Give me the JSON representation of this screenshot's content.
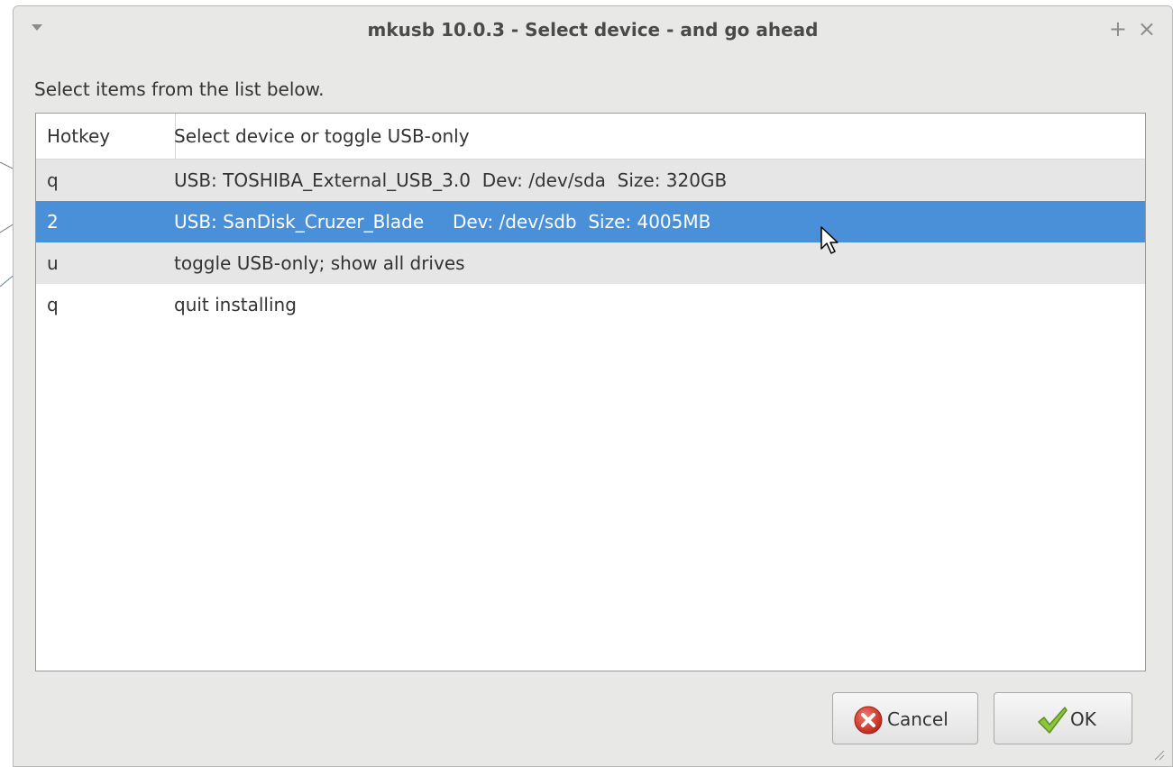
{
  "window": {
    "title": "mkusb 10.0.3 - Select device - and go ahead",
    "menu_icon": "chevron-down-icon",
    "maximize_symbol": "+",
    "close_symbol": "×"
  },
  "prompt": "Select items from the list below.",
  "list": {
    "columns": [
      "Hotkey",
      "Select device or toggle USB-only"
    ],
    "rows": [
      {
        "hotkey": "q",
        "description": "USB: TOSHIBA_External_USB_3.0  Dev: /dev/sda  Size: 320GB"
      },
      {
        "hotkey": "2",
        "description": "USB: SanDisk_Cruzer_Blade     Dev: /dev/sdb  Size: 4005MB"
      },
      {
        "hotkey": "u",
        "description": "toggle USB-only; show all drives"
      },
      {
        "hotkey": "q",
        "description": "quit installing"
      }
    ],
    "selected_index": 1
  },
  "buttons": {
    "cancel_label": "Cancel",
    "ok_label": "OK"
  },
  "colors": {
    "selection": "#4a90d9",
    "window_bg": "#e8e8e7",
    "alt_row": "#e6e6e6",
    "cancel_icon": "#d9382e",
    "ok_icon": "#7bb62a"
  }
}
